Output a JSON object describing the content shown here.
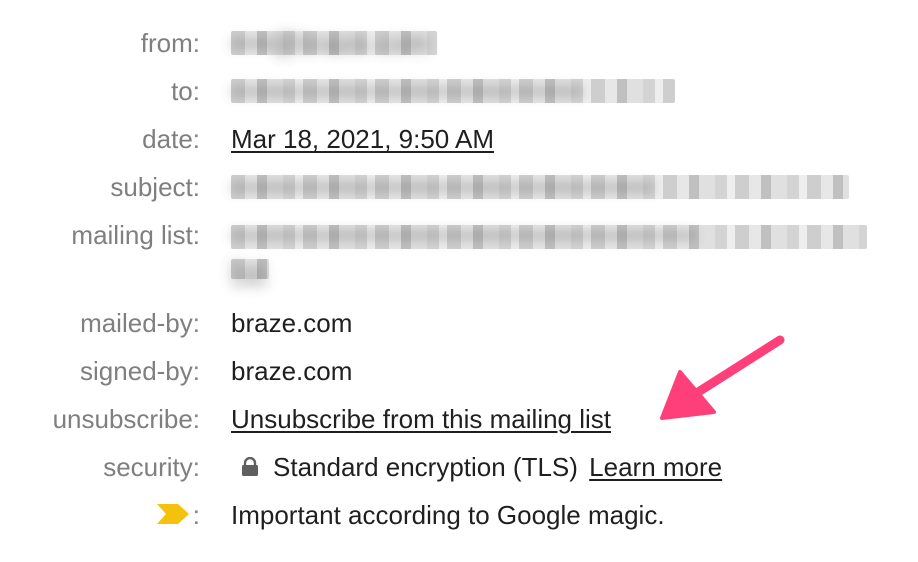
{
  "header": {
    "from": {
      "label": "from:",
      "value": "••••@braze.com"
    },
    "to": {
      "label": "to:",
      "value": "•••••••••••••••••••••••••••••••••••"
    },
    "date": {
      "label": "date:",
      "value": "Mar 18, 2021, 9:50 AM"
    },
    "subject": {
      "label": "subject:",
      "value": "••••••••••••••••••••••••••••••••••••••••••"
    },
    "mailing_list": {
      "label": "mailing list:",
      "value": "••••••••••••••••••••••••••••••••••••••••••••••",
      "value_line2": "list"
    },
    "mailed_by": {
      "label": "mailed-by:",
      "value": "braze.com"
    },
    "signed_by": {
      "label": "signed-by:",
      "value": "braze.com"
    },
    "unsubscribe": {
      "label": "unsubscribe:",
      "value": "Unsubscribe from this mailing list"
    },
    "security": {
      "label": "security:",
      "value": "Standard encryption (TLS)",
      "link": "Learn more"
    },
    "importance": {
      "label": ":",
      "value": "Important according to Google magic."
    }
  },
  "icons": {
    "lock": "lock-icon",
    "importance_marker": "importance-marker-icon",
    "annotation_arrow": "arrow-icon"
  },
  "colors": {
    "label": "#7f7f7f",
    "text": "#1f1f1f",
    "importance": "#f4c20d",
    "arrow": "#ff3f7a"
  }
}
